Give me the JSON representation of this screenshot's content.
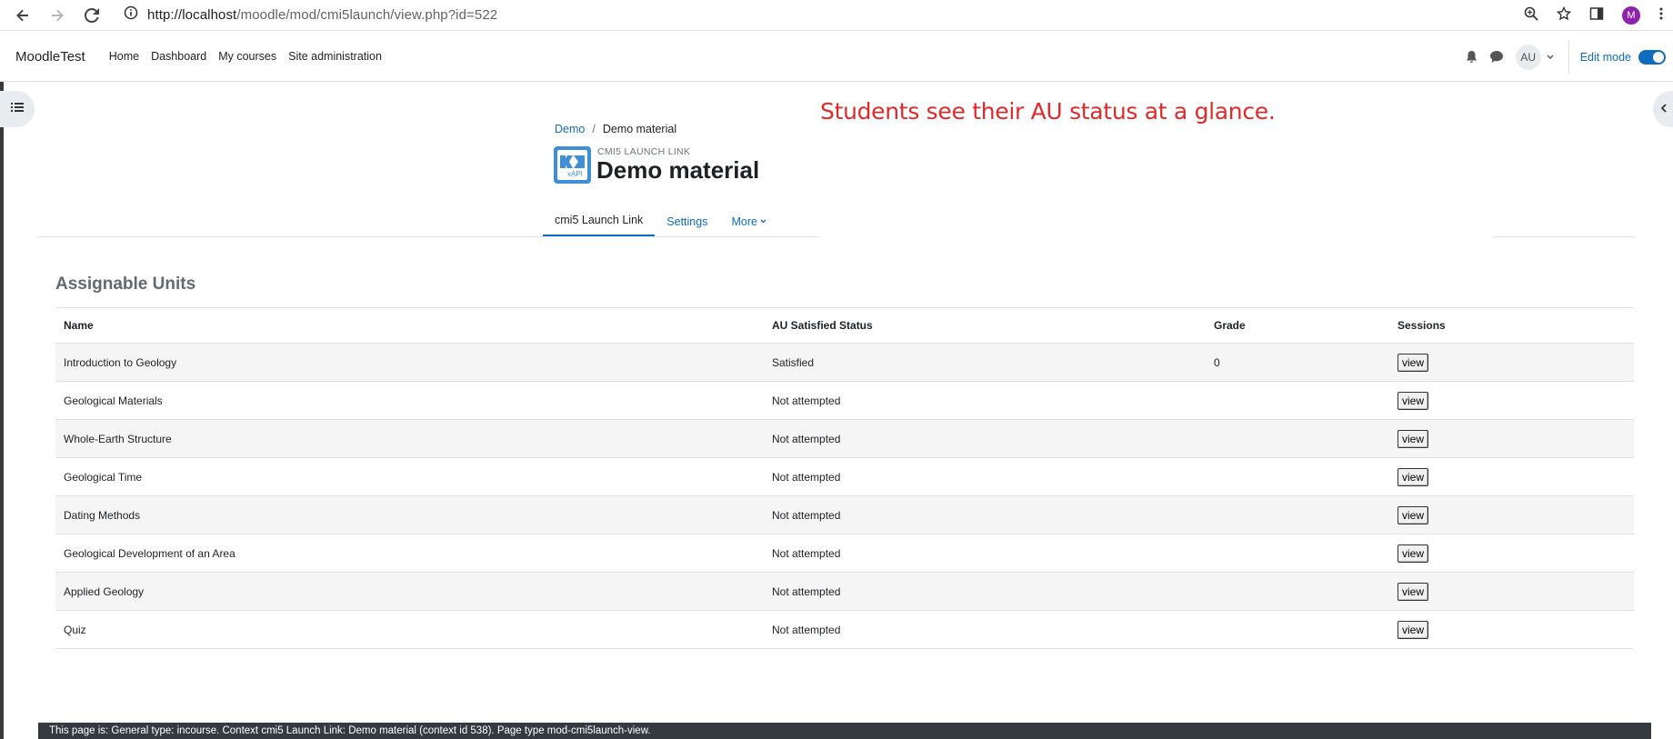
{
  "browser": {
    "url_host": "http://localhost",
    "url_path": "/moodle/mod/cmi5launch/view.php?id=522",
    "profile_initial": "M"
  },
  "navbar": {
    "brand": "MoodleTest",
    "links": [
      "Home",
      "Dashboard",
      "My courses",
      "Site administration"
    ],
    "avatar_initials": "AU",
    "edit_mode_label": "Edit mode"
  },
  "annotation": "Students see their AU status at a glance.",
  "breadcrumb": {
    "items": [
      "Demo",
      "Demo material"
    ],
    "separator": "/"
  },
  "header": {
    "pre_title": "CMI5 LAUNCH LINK",
    "title": "Demo material",
    "icon_text": "xAPI"
  },
  "secondary_nav": {
    "tabs": [
      "cmi5 Launch Link",
      "Settings",
      "More"
    ]
  },
  "section": {
    "title": "Assignable Units"
  },
  "table": {
    "headers": [
      "Name",
      "AU Satisfied Status",
      "Grade",
      "Sessions"
    ],
    "rows": [
      {
        "name": "Introduction to Geology",
        "status": "Satisfied",
        "grade": "0",
        "action": "view"
      },
      {
        "name": "Geological Materials",
        "status": "Not attempted",
        "grade": "",
        "action": "view"
      },
      {
        "name": "Whole-Earth Structure",
        "status": "Not attempted",
        "grade": "",
        "action": "view"
      },
      {
        "name": "Geological Time",
        "status": "Not attempted",
        "grade": "",
        "action": "view"
      },
      {
        "name": "Dating Methods",
        "status": "Not attempted",
        "grade": "",
        "action": "view"
      },
      {
        "name": "Geological Development of an Area",
        "status": "Not attempted",
        "grade": "",
        "action": "view"
      },
      {
        "name": "Applied Geology",
        "status": "Not attempted",
        "grade": "",
        "action": "view"
      },
      {
        "name": "Quiz",
        "status": "Not attempted",
        "grade": "",
        "action": "view"
      }
    ]
  },
  "footer": {
    "text": "This page is: General type: incourse. Context cmi5 Launch Link: Demo material (context id 538). Page type mod-cmi5launch-view."
  },
  "colors": {
    "link": "#0f6cbf",
    "annotation": "#e02a2a",
    "footer_bg": "#343a40"
  }
}
